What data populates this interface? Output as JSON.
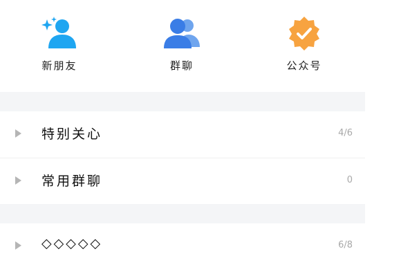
{
  "shortcuts": [
    {
      "label": "新朋友",
      "icon": "new-friend-icon",
      "color": "#1fa6f1"
    },
    {
      "label": "群聊",
      "icon": "group-chat-icon",
      "color": "#3a7de6"
    },
    {
      "label": "公众号",
      "icon": "verified-badge-icon",
      "color": "#f7a340"
    }
  ],
  "groups": [
    {
      "title": "特别关心",
      "count": "4/6"
    },
    {
      "title": "常用群聊",
      "count": "0"
    },
    {
      "title": "◇◇◇◇◇",
      "count": "6/8"
    }
  ],
  "colors": {
    "background": "#ffffff",
    "section_gap": "#f4f5f7",
    "count_text": "#a8a8a8"
  }
}
